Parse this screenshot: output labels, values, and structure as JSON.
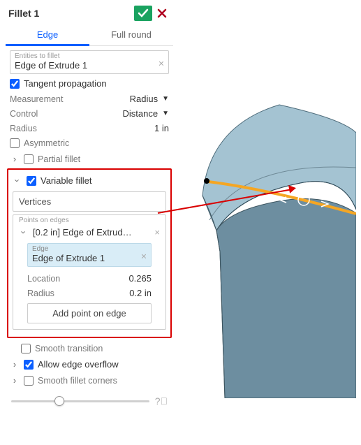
{
  "header": {
    "title": "Fillet 1"
  },
  "tabs": {
    "edge": "Edge",
    "full_round": "Full round"
  },
  "entities": {
    "label": "Entities to fillet",
    "value": "Edge of Extrude 1"
  },
  "tangent": {
    "label": "Tangent propagation",
    "checked": true
  },
  "measurement": {
    "label": "Measurement",
    "value": "Radius"
  },
  "control": {
    "label": "Control",
    "value": "Distance"
  },
  "radius": {
    "label": "Radius",
    "value": "1 in"
  },
  "asymmetric": {
    "label": "Asymmetric",
    "checked": false
  },
  "partial": {
    "label": "Partial fillet",
    "checked": false
  },
  "variable": {
    "label": "Variable fillet",
    "checked": true,
    "vertices_label": "Vertices",
    "points_label": "Points on edges",
    "item_label": "[0.2 in] Edge of Extrud…",
    "edge_label": "Edge",
    "edge_value": "Edge of Extrude 1",
    "location_label": "Location",
    "location_value": "0.265",
    "radius_label": "Radius",
    "radius_value": "0.2 in",
    "add_btn": "Add point on edge"
  },
  "smooth_transition": {
    "label": "Smooth transition",
    "checked": false
  },
  "allow_overflow": {
    "label": "Allow edge overflow",
    "checked": true
  },
  "smooth_corners": {
    "label": "Smooth fillet corners",
    "checked": false
  }
}
